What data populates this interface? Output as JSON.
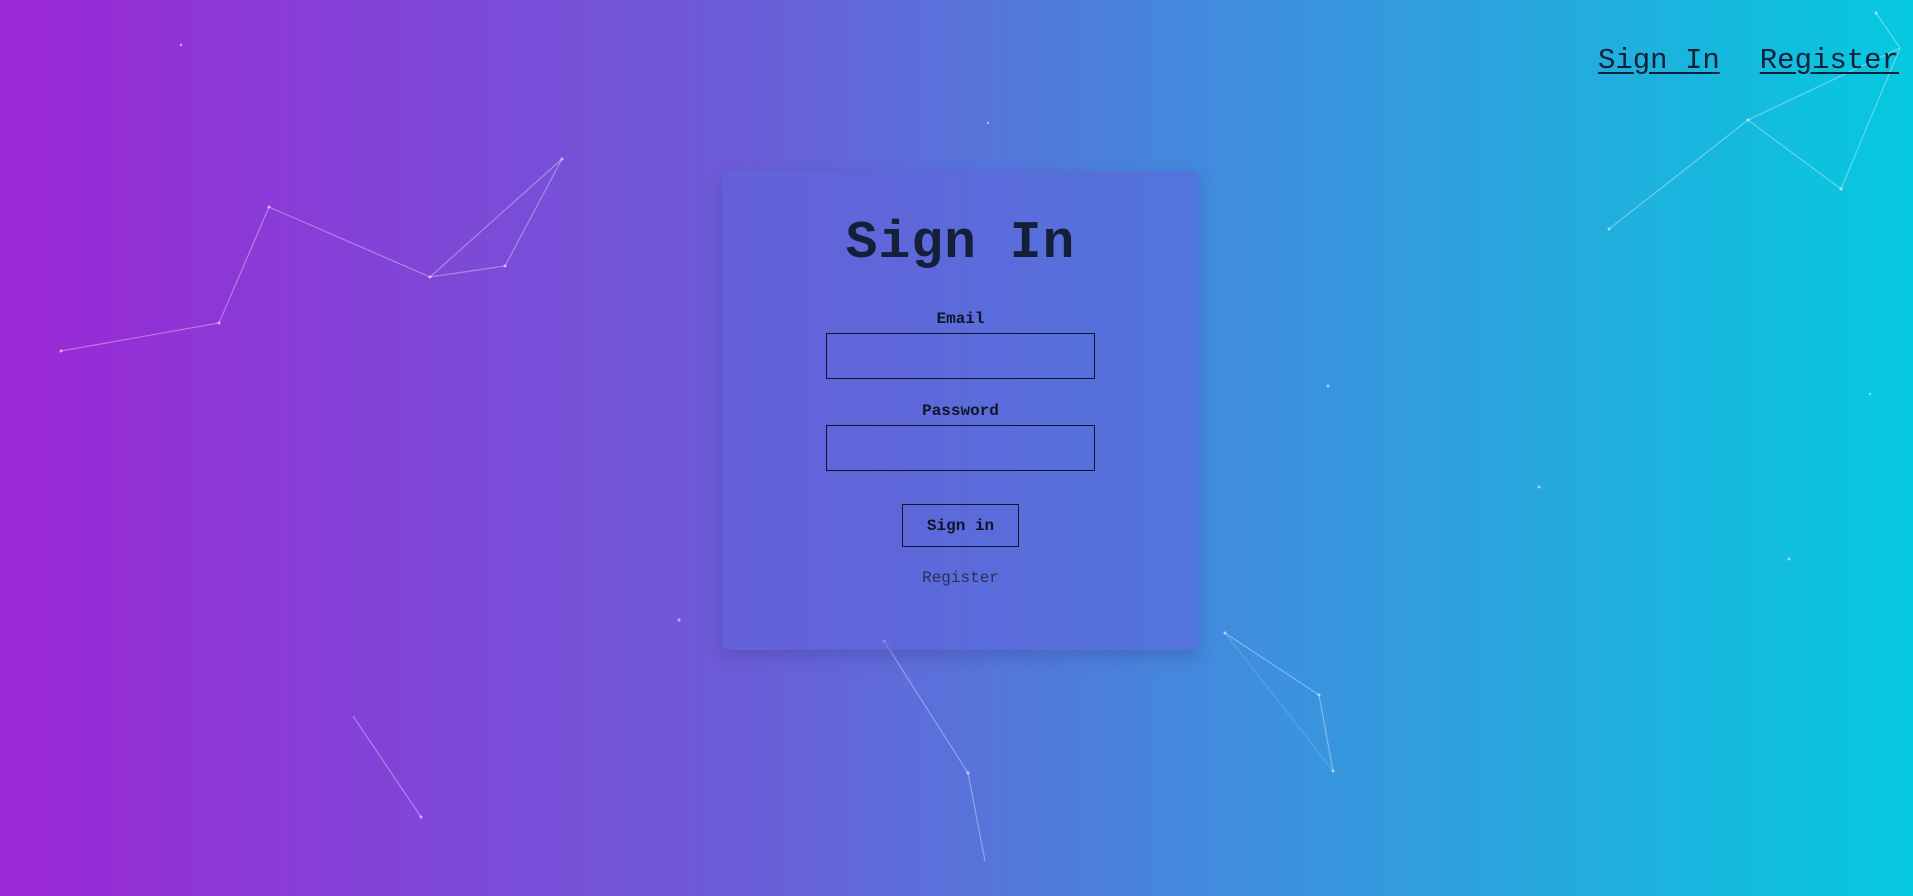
{
  "nav": {
    "signin_label": "Sign In",
    "register_label": "Register"
  },
  "card": {
    "title": "Sign In",
    "email_label": "Email",
    "email_value": "",
    "password_label": "Password",
    "password_value": "",
    "submit_label": "Sign in",
    "register_link": "Register"
  },
  "colors": {
    "gradient_start": "#9b27d6",
    "gradient_end": "#06c9e0",
    "text_dark": "#14203a"
  }
}
